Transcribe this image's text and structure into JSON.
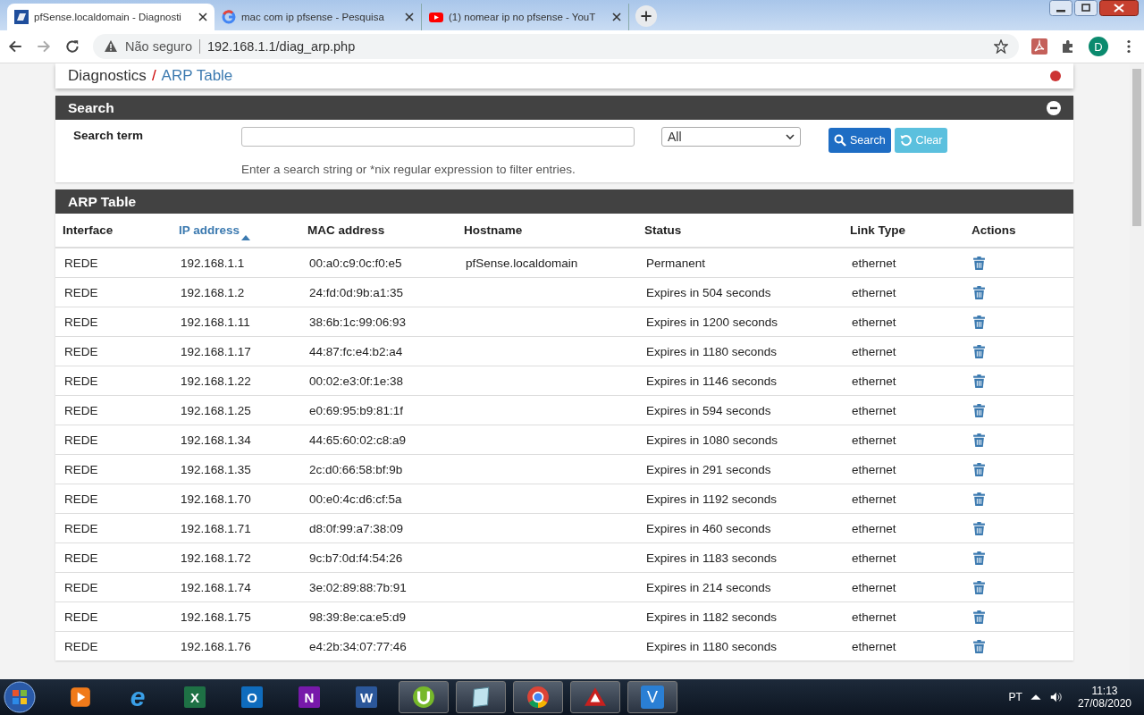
{
  "browser": {
    "tabs": [
      {
        "title": "pfSense.localdomain - Diagnosti",
        "kind": "pf",
        "selected": true
      },
      {
        "title": "mac com ip pfsense - Pesquisa",
        "kind": "google",
        "selected": false
      },
      {
        "title": "(1) nomear ip no pfsense - YouT",
        "kind": "youtube",
        "selected": false
      }
    ],
    "security": "Não seguro",
    "url": "192.168.1.1/diag_arp.php",
    "profile": "D"
  },
  "breadcrumb": {
    "section": "Diagnostics",
    "separator": "/",
    "page": "ARP Table"
  },
  "search_panel": {
    "title": "Search",
    "label": "Search term",
    "filter": "All",
    "search_button": "Search",
    "clear_button": "Clear",
    "help": "Enter a search string or *nix regular expression to filter entries."
  },
  "arp_panel": {
    "title": "ARP Table",
    "columns": [
      {
        "label": "Interface",
        "sorted": false
      },
      {
        "label": "IP address",
        "sorted": true
      },
      {
        "label": "MAC address",
        "sorted": false
      },
      {
        "label": "Hostname",
        "sorted": false
      },
      {
        "label": "Status",
        "sorted": false
      },
      {
        "label": "Link Type",
        "sorted": false
      },
      {
        "label": "Actions",
        "sorted": false
      }
    ],
    "rows": [
      [
        "REDE",
        "192.168.1.1",
        "00:a0:c9:0c:f0:e5",
        "pfSense.localdomain",
        "Permanent",
        "ethernet"
      ],
      [
        "REDE",
        "192.168.1.2",
        "24:fd:0d:9b:a1:35",
        "",
        "Expires in 504 seconds",
        "ethernet"
      ],
      [
        "REDE",
        "192.168.1.11",
        "38:6b:1c:99:06:93",
        "",
        "Expires in 1200 seconds",
        "ethernet"
      ],
      [
        "REDE",
        "192.168.1.17",
        "44:87:fc:e4:b2:a4",
        "",
        "Expires in 1180 seconds",
        "ethernet"
      ],
      [
        "REDE",
        "192.168.1.22",
        "00:02:e3:0f:1e:38",
        "",
        "Expires in 1146 seconds",
        "ethernet"
      ],
      [
        "REDE",
        "192.168.1.25",
        "e0:69:95:b9:81:1f",
        "",
        "Expires in 594 seconds",
        "ethernet"
      ],
      [
        "REDE",
        "192.168.1.34",
        "44:65:60:02:c8:a9",
        "",
        "Expires in 1080 seconds",
        "ethernet"
      ],
      [
        "REDE",
        "192.168.1.35",
        "2c:d0:66:58:bf:9b",
        "",
        "Expires in 291 seconds",
        "ethernet"
      ],
      [
        "REDE",
        "192.168.1.70",
        "00:e0:4c:d6:cf:5a",
        "",
        "Expires in 1192 seconds",
        "ethernet"
      ],
      [
        "REDE",
        "192.168.1.71",
        "d8:0f:99:a7:38:09",
        "",
        "Expires in 460 seconds",
        "ethernet"
      ],
      [
        "REDE",
        "192.168.1.72",
        "9c:b7:0d:f4:54:26",
        "",
        "Expires in 1183 seconds",
        "ethernet"
      ],
      [
        "REDE",
        "192.168.1.74",
        "3e:02:89:88:7b:91",
        "",
        "Expires in 214 seconds",
        "ethernet"
      ],
      [
        "REDE",
        "192.168.1.75",
        "98:39:8e:ca:e5:d9",
        "",
        "Expires in 1182 seconds",
        "ethernet"
      ],
      [
        "REDE",
        "192.168.1.76",
        "e4:2b:34:07:77:46",
        "",
        "Expires in 1180 seconds",
        "ethernet"
      ]
    ]
  },
  "taskbar": {
    "apps": [
      {
        "kind": "media",
        "active": false
      },
      {
        "kind": "ie",
        "glyph": "e",
        "active": false
      },
      {
        "kind": "office",
        "glyph": "X",
        "color": "#1e7145",
        "active": false
      },
      {
        "kind": "office",
        "glyph": "O",
        "color": "#0f6cbd",
        "active": false
      },
      {
        "kind": "office",
        "glyph": "N",
        "color": "#7719aa",
        "active": false
      },
      {
        "kind": "office",
        "glyph": "W",
        "color": "#2b579a",
        "active": false
      },
      {
        "kind": "torrent",
        "active": true
      },
      {
        "kind": "notes",
        "active": true
      },
      {
        "kind": "chrome",
        "active": true
      },
      {
        "kind": "triangle",
        "active": true
      },
      {
        "kind": "vnc",
        "glyph": "V",
        "active": true
      }
    ],
    "language": "PT",
    "time": "11:13",
    "date": "27/08/2020"
  }
}
